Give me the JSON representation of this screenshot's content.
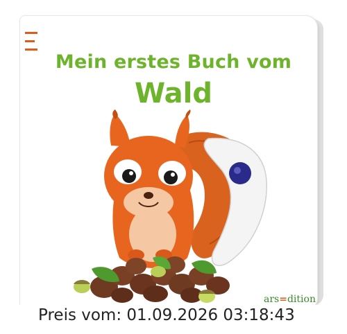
{
  "book": {
    "title_line1": "Mein erstes Buch vom",
    "title_line2": "Wald",
    "publisher_pre": "ars",
    "publisher_post": "dition",
    "cover_illustration": "squirrel-on-acorns",
    "brand_color": "#6db32c",
    "accent_color": "#e05a1a"
  },
  "overlay": {
    "price_label": "Preis vom: 01.09.2026 03:18:43"
  }
}
